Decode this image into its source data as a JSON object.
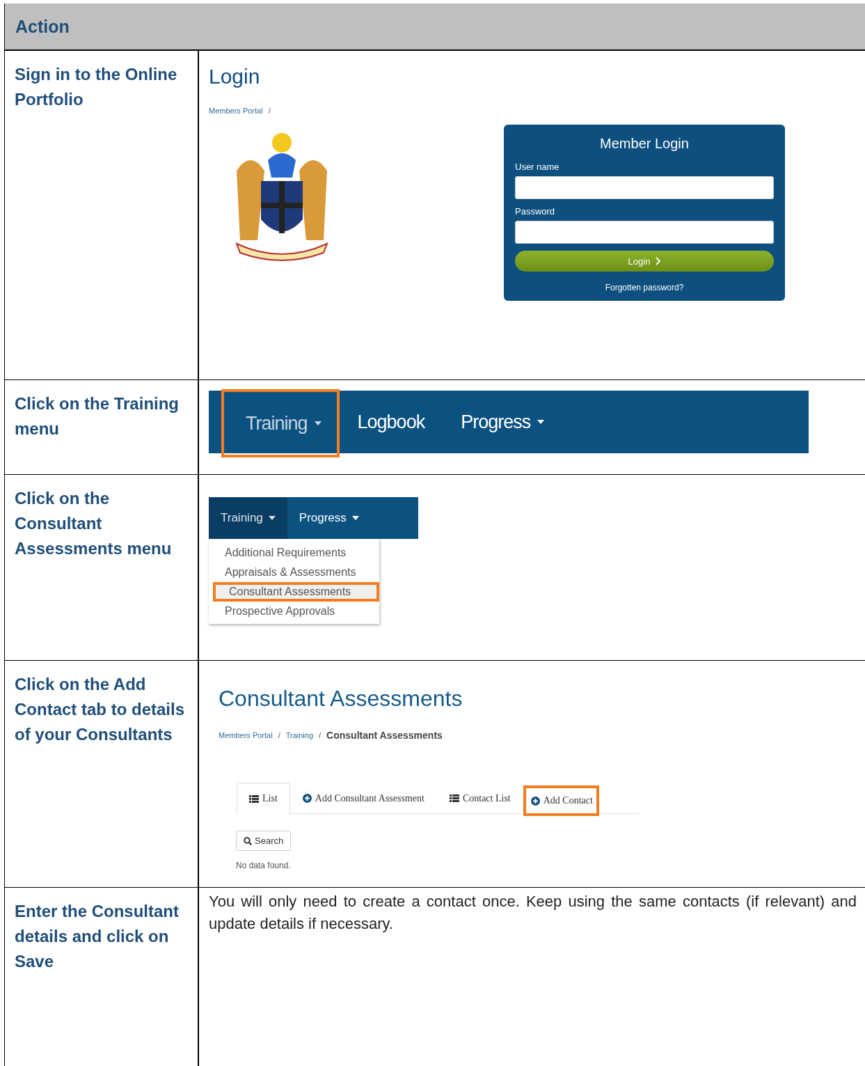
{
  "header": "Action",
  "rows": [
    {
      "action": "Sign in to the Online Portfolio",
      "panel": {
        "kind": "login",
        "title": "Login",
        "breadcrumb": [
          {
            "label": "Members Portal",
            "current": false,
            "separator": "/"
          }
        ],
        "box": {
          "title": "Member Login",
          "fields": [
            {
              "label": "User name"
            },
            {
              "label": "Password"
            }
          ],
          "button": "Login",
          "link": "Forgotten password?"
        }
      }
    },
    {
      "action": "Click on the Training menu",
      "panel": {
        "kind": "navbar",
        "items": [
          {
            "label": "Training",
            "caret": true,
            "highlighted": true
          },
          {
            "label": "Logbook",
            "caret": false,
            "highlighted": false
          },
          {
            "label": "Progress",
            "caret": true,
            "highlighted": false
          }
        ]
      }
    },
    {
      "action": "Click on the Consultant Assessments menu",
      "panel": {
        "kind": "dropdown",
        "items": [
          {
            "label": "Training",
            "caret": true,
            "selected": true
          },
          {
            "label": "Progress",
            "caret": true,
            "selected": false
          }
        ],
        "menu": [
          {
            "label": "Additional Requirements",
            "highlighted": false
          },
          {
            "label": "Appraisals & Assessments",
            "highlighted": false
          },
          {
            "label": "Consultant Assessments",
            "highlighted": true
          },
          {
            "label": "Prospective Approvals",
            "highlighted": false
          }
        ]
      }
    },
    {
      "action": "Click on the Add Contact tab to details of your Consultants",
      "panel": {
        "kind": "page",
        "title": "Consultant Assessments",
        "breadcrumb": [
          {
            "label": "Members Portal",
            "current": false,
            "separator": "/"
          },
          {
            "label": "Training",
            "current": false,
            "separator": "/"
          },
          {
            "label": "Consultant Assessments",
            "current": true
          }
        ],
        "tabs": [
          {
            "label": "List",
            "kind": "list",
            "selected": true,
            "highlighted": false
          },
          {
            "label": "Add Consultant Assessment",
            "kind": "add",
            "selected": false,
            "highlighted": false
          },
          {
            "label": "Contact List",
            "kind": "list",
            "selected": false,
            "highlighted": false
          },
          {
            "label": "Add Contact",
            "kind": "add",
            "selected": false,
            "highlighted": true
          }
        ],
        "search_button": "Search",
        "empty": "No data found."
      }
    },
    {
      "action": "Enter the Consultant details and click on Save",
      "panel": {
        "kind": "text",
        "text": "You will only need to create a contact once. Keep using the same contacts (if relevant) and update details if necessary."
      }
    }
  ]
}
